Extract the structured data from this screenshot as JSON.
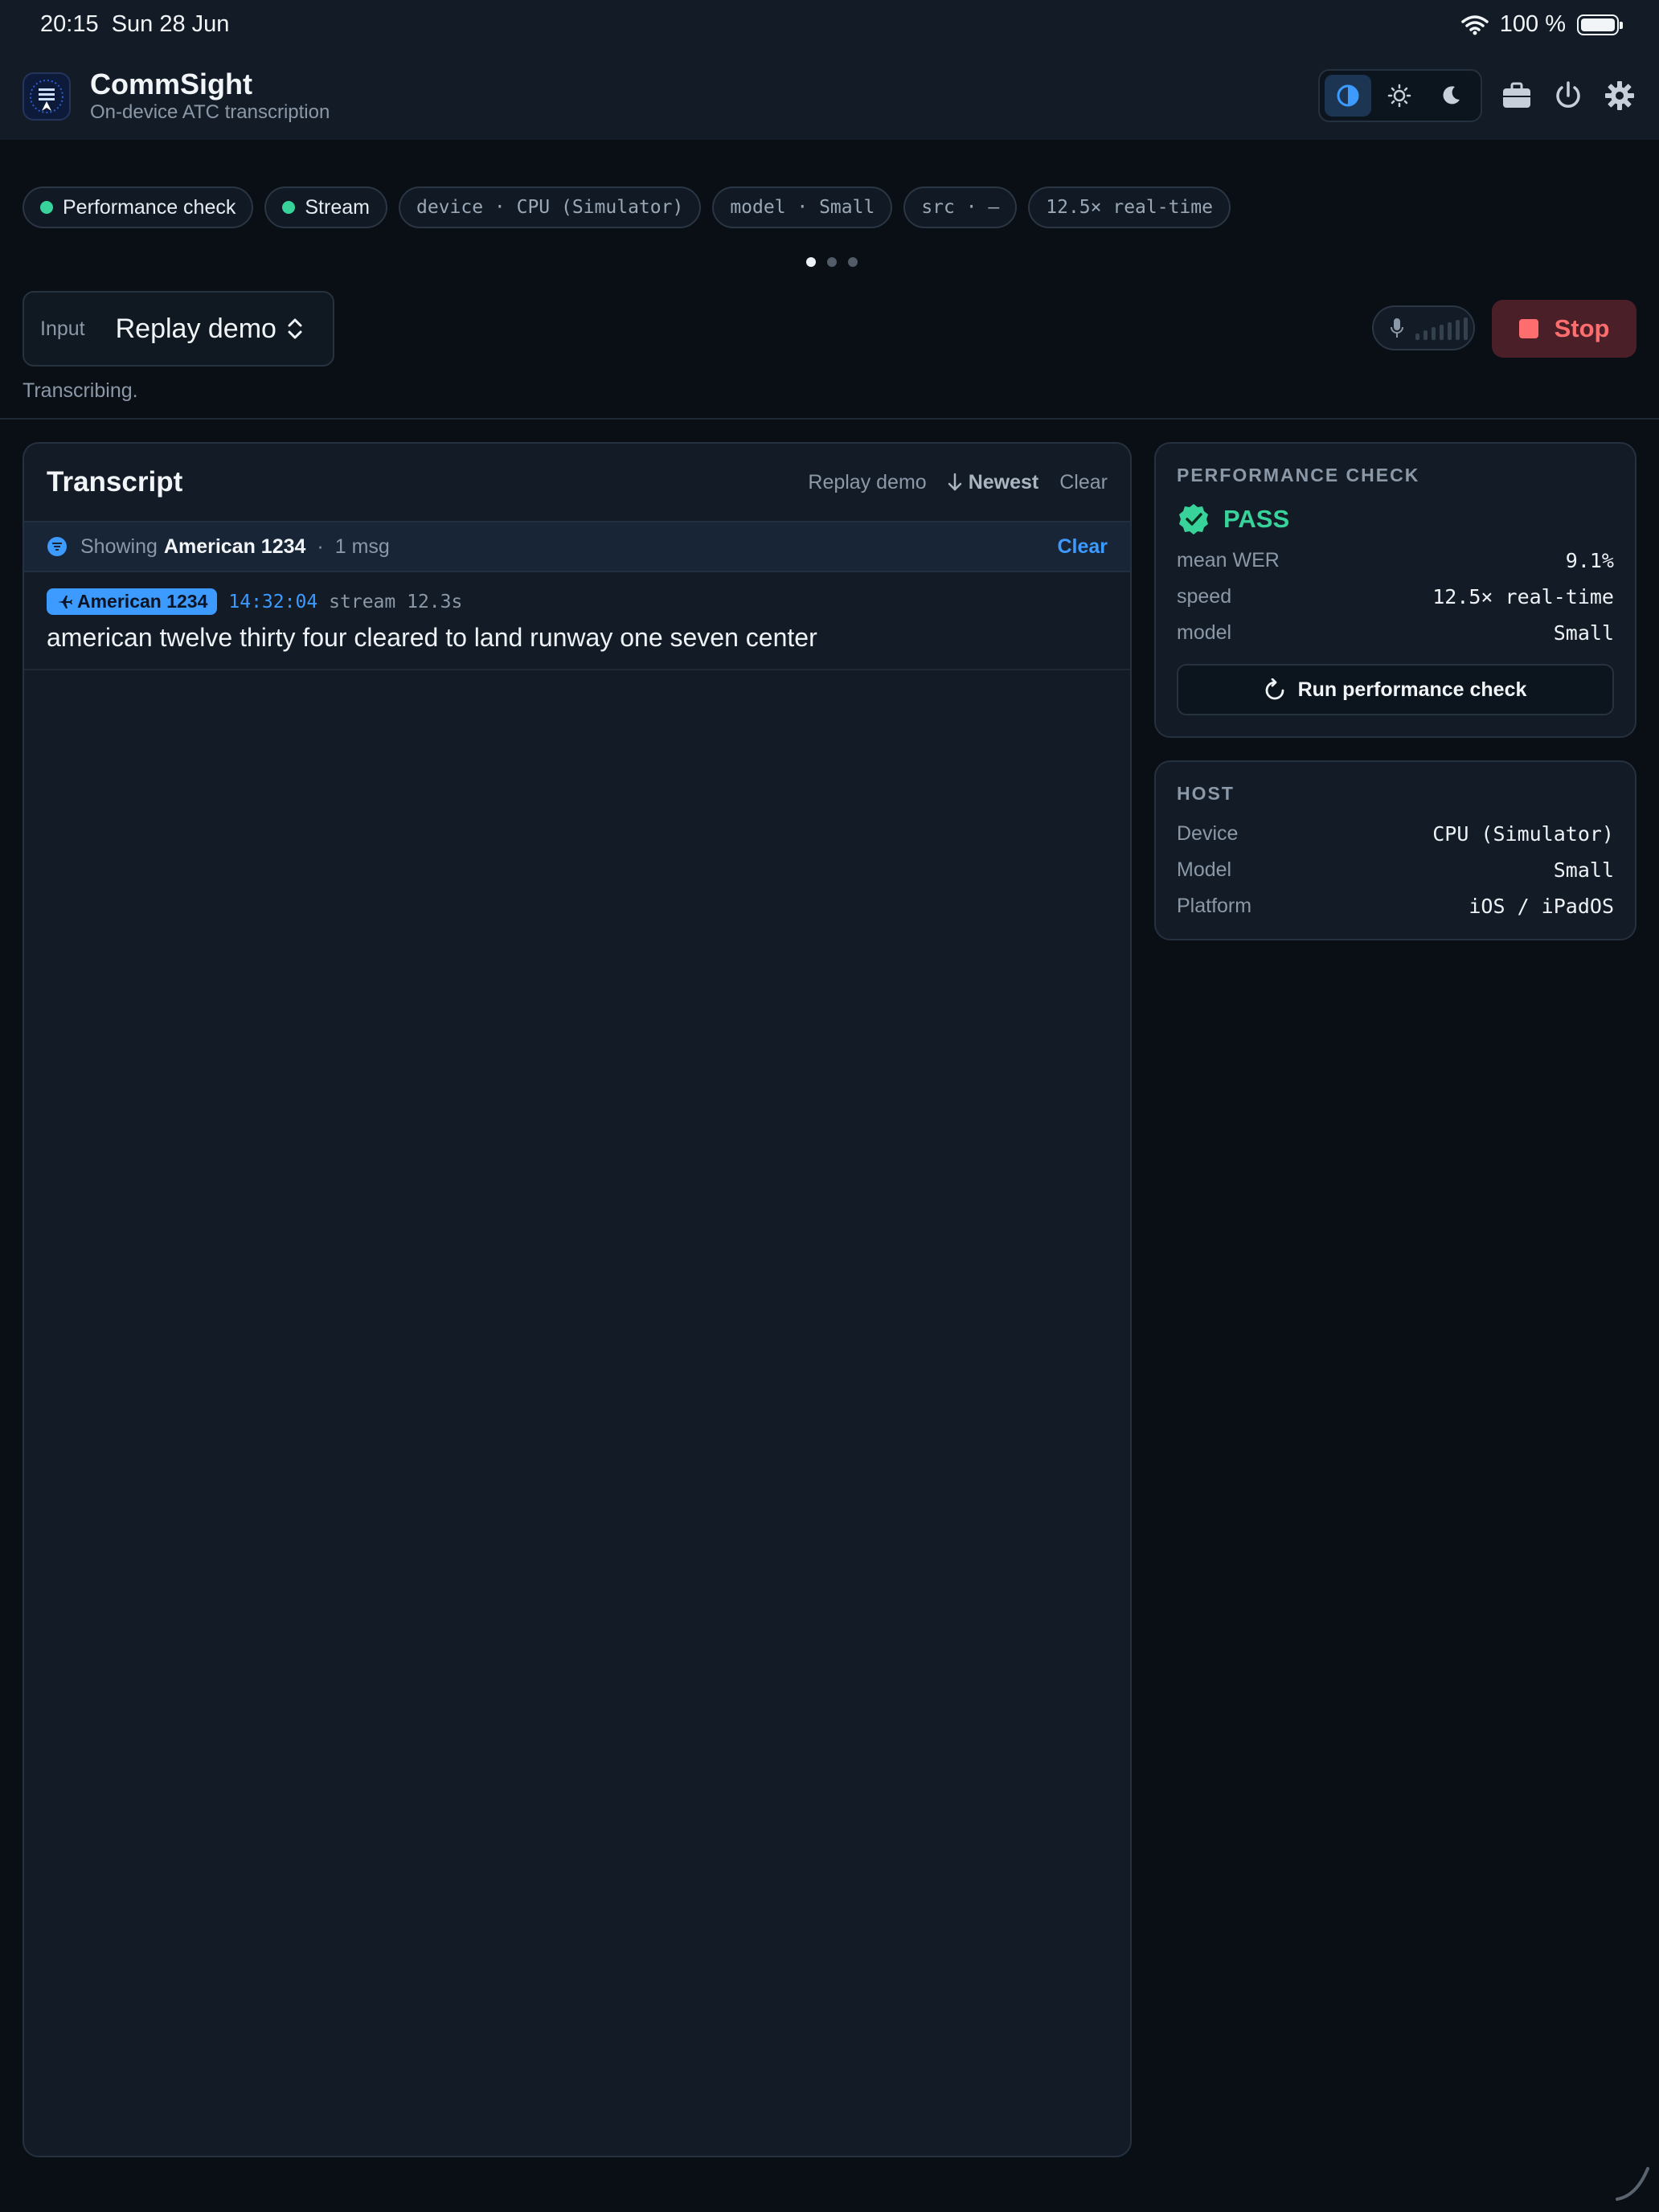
{
  "status_bar": {
    "time": "20:15",
    "date": "Sun 28 Jun",
    "battery": "100 %"
  },
  "header": {
    "title": "CommSight",
    "subtitle": "On-device ATC transcription",
    "theme_modes": [
      "auto-theme-icon",
      "sun-icon",
      "moon-icon"
    ],
    "active_theme": "auto"
  },
  "chips": {
    "perf": "Performance check",
    "stream": "Stream",
    "device": "device · CPU (Simulator)",
    "model": "model · Small",
    "src": "src · —",
    "speed": "12.5× real-time"
  },
  "pager": {
    "count": 3,
    "active": 0
  },
  "input": {
    "label": "Input",
    "value": "Replay demo"
  },
  "status_text": "Transcribing.",
  "stop_label": "Stop",
  "transcript": {
    "title": "Transcript",
    "actions": {
      "replay": "Replay demo",
      "newest": "Newest",
      "clear": "Clear"
    },
    "filter": {
      "showing": "Showing",
      "callsign": "American 1234",
      "count": "1 msg",
      "clear": "Clear"
    },
    "messages": [
      {
        "callsign": "American 1234",
        "time": "14:32:04",
        "meta": "stream 12.3s",
        "text": "american twelve thirty four cleared to land runway one seven center"
      }
    ]
  },
  "perf_card": {
    "heading": "PERFORMANCE CHECK",
    "result": "PASS",
    "rows": [
      {
        "k": "mean WER",
        "v": "9.1%"
      },
      {
        "k": "speed",
        "v": "12.5× real-time"
      },
      {
        "k": "model",
        "v": "Small"
      }
    ],
    "button": "Run performance check"
  },
  "host_card": {
    "heading": "HOST",
    "rows": [
      {
        "k": "Device",
        "v": "CPU (Simulator)"
      },
      {
        "k": "Model",
        "v": "Small"
      },
      {
        "k": "Platform",
        "v": "iOS / iPadOS"
      }
    ]
  },
  "colors": {
    "accent": "#3d9bff",
    "success": "#37d39a",
    "danger": "#ff6e6e",
    "background": "#0a0e15"
  }
}
